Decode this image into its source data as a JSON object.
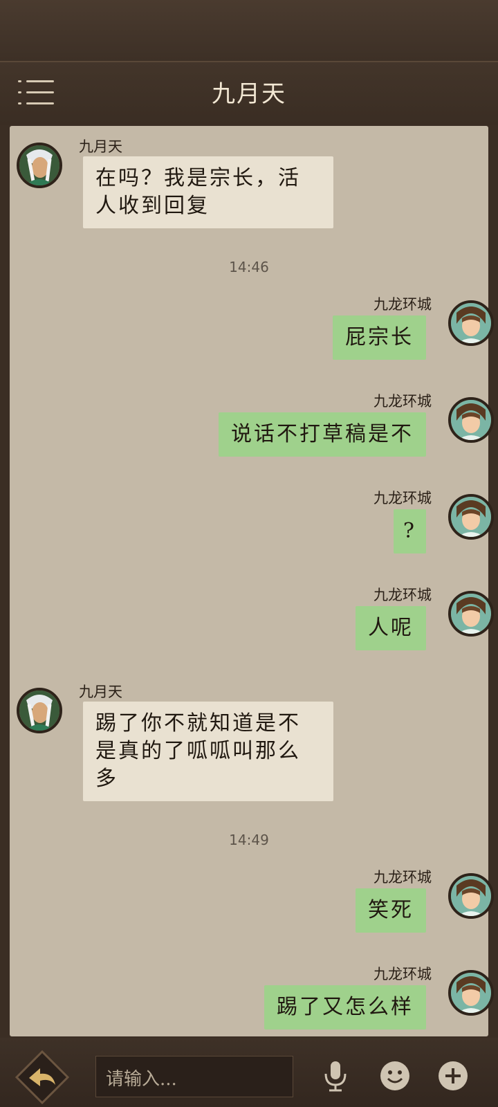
{
  "header": {
    "title": "九月天"
  },
  "input": {
    "placeholder": "请输入..."
  },
  "messages": [
    {
      "sender": "九月天",
      "text": "在吗？我是宗长，活人收到回复"
    },
    {
      "time": "14:46"
    },
    {
      "sender": "九龙环城",
      "text": "屁宗长"
    },
    {
      "sender": "九龙环城",
      "text": "说话不打草稿是不"
    },
    {
      "sender": "九龙环城",
      "text": "?"
    },
    {
      "sender": "九龙环城",
      "text": "人呢"
    },
    {
      "sender": "九月天",
      "text": "踢了你不就知道是不是真的了呱呱叫那么多"
    },
    {
      "time": "14:49"
    },
    {
      "sender": "九龙环城",
      "text": "笑死"
    },
    {
      "sender": "九龙环城",
      "text": "踢了又怎么样"
    }
  ],
  "icons": {
    "menu": "menu-icon",
    "back": "back-arrow-icon",
    "mic": "microphone-icon",
    "emoji": "smiley-icon",
    "plus": "plus-icon"
  },
  "colors": {
    "incoming_bubble": "#e9e1d1",
    "outgoing_bubble": "#9fd18c",
    "chat_bg": "#c4b9a7"
  }
}
